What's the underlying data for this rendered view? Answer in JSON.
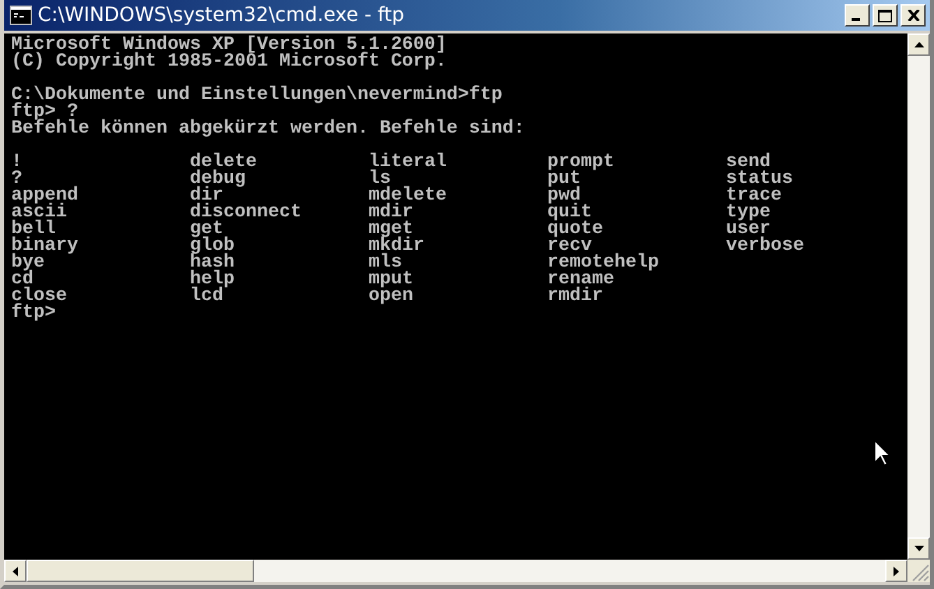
{
  "window": {
    "title": "C:\\WINDOWS\\system32\\cmd.exe - ftp"
  },
  "console": {
    "blocks": [
      [
        "Microsoft Windows XP [Version 5.1.2600]",
        "(C) Copyright 1985-2001 Microsoft Corp."
      ],
      [
        "C:\\Dokumente und Einstellungen\\nevermind>ftp",
        "ftp> ?",
        "Befehle können abgekürzt werden. Befehle sind:"
      ]
    ],
    "command_columns": [
      [
        "!",
        "?",
        "append",
        "ascii",
        "bell",
        "binary",
        "bye",
        "cd",
        "close"
      ],
      [
        "delete",
        "debug",
        "dir",
        "disconnect",
        "get",
        "glob",
        "hash",
        "help",
        "lcd"
      ],
      [
        "literal",
        "ls",
        "mdelete",
        "mdir",
        "mget",
        "mkdir",
        "mls",
        "mput",
        "open"
      ],
      [
        "prompt",
        "put",
        "pwd",
        "quit",
        "quote",
        "recv",
        "remotehelp",
        "rename",
        "rmdir"
      ],
      [
        "send",
        "status",
        "trace",
        "type",
        "user",
        "verbose"
      ]
    ],
    "lines_after": [
      "ftp>"
    ]
  }
}
